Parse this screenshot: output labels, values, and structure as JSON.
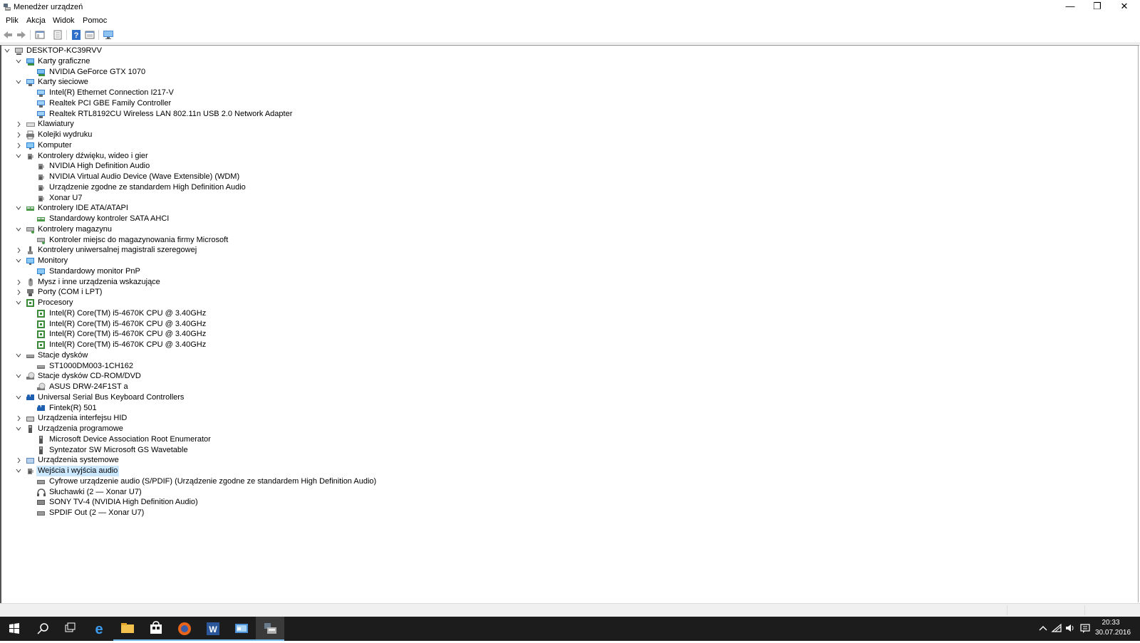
{
  "window": {
    "title": "Menedżer urządzeń",
    "minimize_label": "—",
    "restore_label": "❐",
    "close_label": "✕"
  },
  "menu": [
    "Plik",
    "Akcja",
    "Widok",
    "Pomoc"
  ],
  "toolbar": [
    "back-icon",
    "forward-icon",
    "tree-view-icon",
    "properties-icon",
    "help-icon",
    "details-view-icon",
    "monitor-scan-icon"
  ],
  "tree": [
    {
      "label": "DESKTOP-KC39RVV",
      "level": 0,
      "state": "expanded",
      "icon": "computer-icon"
    },
    {
      "label": "Karty graficzne",
      "level": 1,
      "state": "expanded",
      "icon": "display-adapter-icon"
    },
    {
      "label": "NVIDIA GeForce GTX 1070",
      "level": 2,
      "state": "leaf",
      "icon": "display-adapter-icon"
    },
    {
      "label": "Karty sieciowe",
      "level": 1,
      "state": "expanded",
      "icon": "network-icon"
    },
    {
      "label": "Intel(R) Ethernet Connection I217-V",
      "level": 2,
      "state": "leaf",
      "icon": "network-icon"
    },
    {
      "label": "Realtek PCI GBE Family Controller",
      "level": 2,
      "state": "leaf",
      "icon": "network-icon"
    },
    {
      "label": "Realtek RTL8192CU Wireless LAN 802.11n USB 2.0 Network Adapter",
      "level": 2,
      "state": "leaf",
      "icon": "network-icon"
    },
    {
      "label": "Klawiatury",
      "level": 1,
      "state": "collapsed",
      "icon": "keyboard-icon"
    },
    {
      "label": "Kolejki wydruku",
      "level": 1,
      "state": "collapsed",
      "icon": "printer-icon"
    },
    {
      "label": "Komputer",
      "level": 1,
      "state": "collapsed",
      "icon": "monitor-icon"
    },
    {
      "label": "Kontrolery dźwięku, wideo i gier",
      "level": 1,
      "state": "expanded",
      "icon": "speaker-icon"
    },
    {
      "label": "NVIDIA High Definition Audio",
      "level": 2,
      "state": "leaf",
      "icon": "speaker-icon"
    },
    {
      "label": "NVIDIA Virtual Audio Device (Wave Extensible) (WDM)",
      "level": 2,
      "state": "leaf",
      "icon": "speaker-icon"
    },
    {
      "label": "Urządzenie zgodne ze standardem High Definition Audio",
      "level": 2,
      "state": "leaf",
      "icon": "speaker-icon"
    },
    {
      "label": "Xonar U7",
      "level": 2,
      "state": "leaf",
      "icon": "speaker-icon"
    },
    {
      "label": "Kontrolery IDE ATA/ATAPI",
      "level": 1,
      "state": "expanded",
      "icon": "controller-icon"
    },
    {
      "label": "Standardowy kontroler SATA AHCI",
      "level": 2,
      "state": "leaf",
      "icon": "controller-icon"
    },
    {
      "label": "Kontrolery magazynu",
      "level": 1,
      "state": "expanded",
      "icon": "storage-controller-icon"
    },
    {
      "label": "Kontroler miejsc do magazynowania firmy Microsoft",
      "level": 2,
      "state": "leaf",
      "icon": "storage-controller-icon"
    },
    {
      "label": "Kontrolery uniwersalnej magistrali szeregowej",
      "level": 1,
      "state": "collapsed",
      "icon": "usb-icon"
    },
    {
      "label": "Monitory",
      "level": 1,
      "state": "expanded",
      "icon": "monitor-icon"
    },
    {
      "label": "Standardowy monitor PnP",
      "level": 2,
      "state": "leaf",
      "icon": "monitor-icon"
    },
    {
      "label": "Mysz i inne urządzenia wskazujące",
      "level": 1,
      "state": "collapsed",
      "icon": "mouse-icon"
    },
    {
      "label": "Porty (COM i LPT)",
      "level": 1,
      "state": "collapsed",
      "icon": "port-icon"
    },
    {
      "label": "Procesory",
      "level": 1,
      "state": "expanded",
      "icon": "cpu-icon"
    },
    {
      "label": "Intel(R) Core(TM) i5-4670K CPU @ 3.40GHz",
      "level": 2,
      "state": "leaf",
      "icon": "cpu-icon"
    },
    {
      "label": "Intel(R) Core(TM) i5-4670K CPU @ 3.40GHz",
      "level": 2,
      "state": "leaf",
      "icon": "cpu-icon"
    },
    {
      "label": "Intel(R) Core(TM) i5-4670K CPU @ 3.40GHz",
      "level": 2,
      "state": "leaf",
      "icon": "cpu-icon"
    },
    {
      "label": "Intel(R) Core(TM) i5-4670K CPU @ 3.40GHz",
      "level": 2,
      "state": "leaf",
      "icon": "cpu-icon"
    },
    {
      "label": "Stacje dysków",
      "level": 1,
      "state": "expanded",
      "icon": "disk-drive-icon"
    },
    {
      "label": "ST1000DM003-1CH162",
      "level": 2,
      "state": "leaf",
      "icon": "disk-drive-icon"
    },
    {
      "label": "Stacje dysków CD-ROM/DVD",
      "level": 1,
      "state": "expanded",
      "icon": "dvd-drive-icon"
    },
    {
      "label": "ASUS DRW-24F1ST   a",
      "level": 2,
      "state": "leaf",
      "icon": "dvd-drive-icon"
    },
    {
      "label": "Universal Serial Bus Keyboard Controllers",
      "level": 1,
      "state": "expanded",
      "icon": "usb-keyboard-icon"
    },
    {
      "label": "Fintek(R) 501",
      "level": 2,
      "state": "leaf",
      "icon": "usb-keyboard-icon"
    },
    {
      "label": "Urządzenia interfejsu HID",
      "level": 1,
      "state": "collapsed",
      "icon": "hid-icon"
    },
    {
      "label": "Urządzenia programowe",
      "level": 1,
      "state": "expanded",
      "icon": "software-device-icon"
    },
    {
      "label": "Microsoft Device Association Root Enumerator",
      "level": 2,
      "state": "leaf",
      "icon": "software-device-icon"
    },
    {
      "label": "Syntezator SW Microsoft GS Wavetable",
      "level": 2,
      "state": "leaf",
      "icon": "software-device-icon"
    },
    {
      "label": "Urządzenia systemowe",
      "level": 1,
      "state": "collapsed",
      "icon": "system-device-icon"
    },
    {
      "label": "Wejścia i wyjścia audio",
      "level": 1,
      "state": "expanded",
      "icon": "audio-io-icon",
      "selected": true
    },
    {
      "label": "Cyfrowe urządzenie audio (S/PDIF) (Urządzenie zgodne ze standardem High Definition Audio)",
      "level": 2,
      "state": "leaf",
      "icon": "audio-output-icon"
    },
    {
      "label": "Słuchawki (2 — Xonar U7)",
      "level": 2,
      "state": "leaf",
      "icon": "headphones-icon"
    },
    {
      "label": "SONY TV-4 (NVIDIA High Definition Audio)",
      "level": 2,
      "state": "leaf",
      "icon": "tv-audio-icon"
    },
    {
      "label": "SPDIF Out (2 — Xonar U7)",
      "level": 2,
      "state": "leaf",
      "icon": "audio-output-icon"
    }
  ],
  "taskbar": {
    "apps": [
      "start-icon",
      "search-icon",
      "task-view-icon",
      "edge-icon",
      "file-explorer-icon",
      "store-icon",
      "firefox-icon",
      "word-icon",
      "control-panel-icon",
      "device-manager-icon"
    ],
    "active_index": 9,
    "time": "20:33",
    "date": "30.07.2016"
  },
  "colors": {
    "selection": "#cce8ff",
    "taskbar": "#1c1c1c",
    "accent": "#76b9ed"
  }
}
